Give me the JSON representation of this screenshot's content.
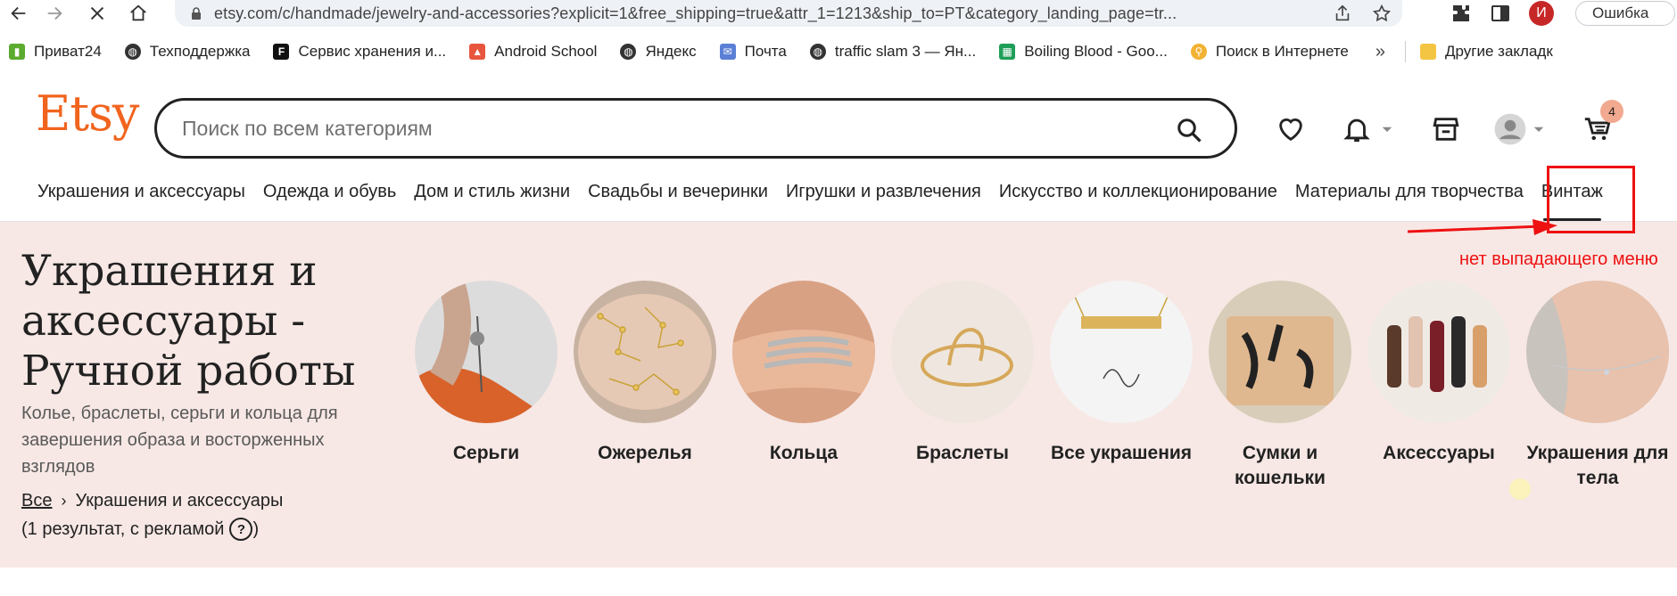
{
  "browser": {
    "url": "etsy.com/c/handmade/jewelry-and-accessories?explicit=1&free_shipping=true&attr_1=1213&ship_to=PT&category_landing_page=tr...",
    "profile_initial": "И",
    "error_label": "Ошибка",
    "bookmarks": [
      {
        "label": "Приват24",
        "icon": "privat24-icon"
      },
      {
        "label": "Техподдержка",
        "icon": "globe-icon"
      },
      {
        "label": "Сервис хранения и...",
        "icon": "f-logo-icon"
      },
      {
        "label": "Android School",
        "icon": "android-school-icon"
      },
      {
        "label": "Яндекс",
        "icon": "globe-icon"
      },
      {
        "label": "Почта",
        "icon": "mail-icon"
      },
      {
        "label": "traffic slam 3 — Ян...",
        "icon": "globe-icon"
      },
      {
        "label": "Boiling Blood - Goo...",
        "icon": "sheets-icon"
      },
      {
        "label": "Поиск в Интернете",
        "icon": "search-web-icon"
      }
    ],
    "bookmarks_more": "»",
    "other_bookmarks": "Другие закладк"
  },
  "site": {
    "logo": "Etsy",
    "search_placeholder": "Поиск по всем категориям",
    "cart_count": "4",
    "categories": [
      "Украшения и аксессуары",
      "Одежда и обувь",
      "Дом и стиль жизни",
      "Свадьбы и вечеринки",
      "Игрушки и развлечения",
      "Искусство и коллекционирование",
      "Материалы для творчества",
      "Винтаж"
    ]
  },
  "annotation": {
    "text": "нет выпадающего меню",
    "color": "#e11111"
  },
  "hero": {
    "title": "Украшения и аксессуары - Ручной работы",
    "description": "Колье, браслеты, серьги и кольца для завершения образа и восторженных взглядов",
    "breadcrumb_root": "Все",
    "breadcrumb_sep": "›",
    "breadcrumb_current": "Украшения и аксессуары",
    "results_text": "(1 результат, с рекламой",
    "results_close": ")",
    "help": "?",
    "categories": [
      {
        "label": "Серьги"
      },
      {
        "label": "Ожерелья"
      },
      {
        "label": "Кольца"
      },
      {
        "label": "Браслеты"
      },
      {
        "label": "Все украшения"
      },
      {
        "label": "Сумки и кошельки"
      },
      {
        "label": "Аксессуары"
      },
      {
        "label": "Украшения для тела"
      }
    ]
  },
  "colors": {
    "brand": "#f1641e",
    "hero_bg": "#f7e8e5",
    "annotation_red": "#e11111"
  }
}
